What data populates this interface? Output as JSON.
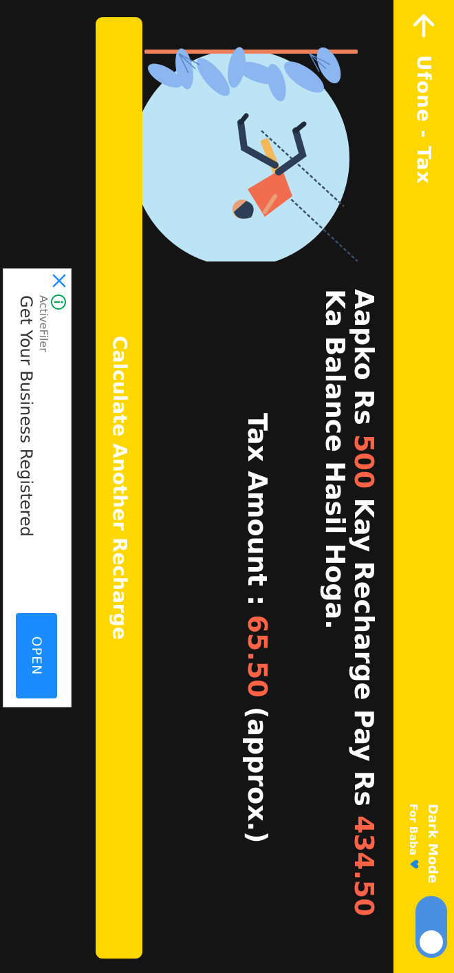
{
  "appbar": {
    "title": "Ufone - Tax",
    "dark_mode_label": "Dark Mode",
    "dark_mode_sub": "For Baba",
    "dark_mode_on": true,
    "colors": {
      "background": "#FFD700",
      "toggle": "#4A90E2"
    }
  },
  "result": {
    "line_prefix": "Aapko Rs ",
    "recharge_amount": "500",
    "line_middle": " Kay Recharge Pay Rs ",
    "balance_amount": "434.50",
    "line_suffix": " Ka Balance Hasil Hoga.",
    "tax_label": "Tax Amount : ",
    "tax_amount": "65.50",
    "tax_suffix": " (approx.)",
    "highlight_color": "#FF6347"
  },
  "actions": {
    "recalculate_label": "Calculate Another Recharge"
  },
  "ad": {
    "sponsor": "ActiveFiler",
    "headline": "Get Your Business Registered",
    "open_label": "OPEN"
  }
}
